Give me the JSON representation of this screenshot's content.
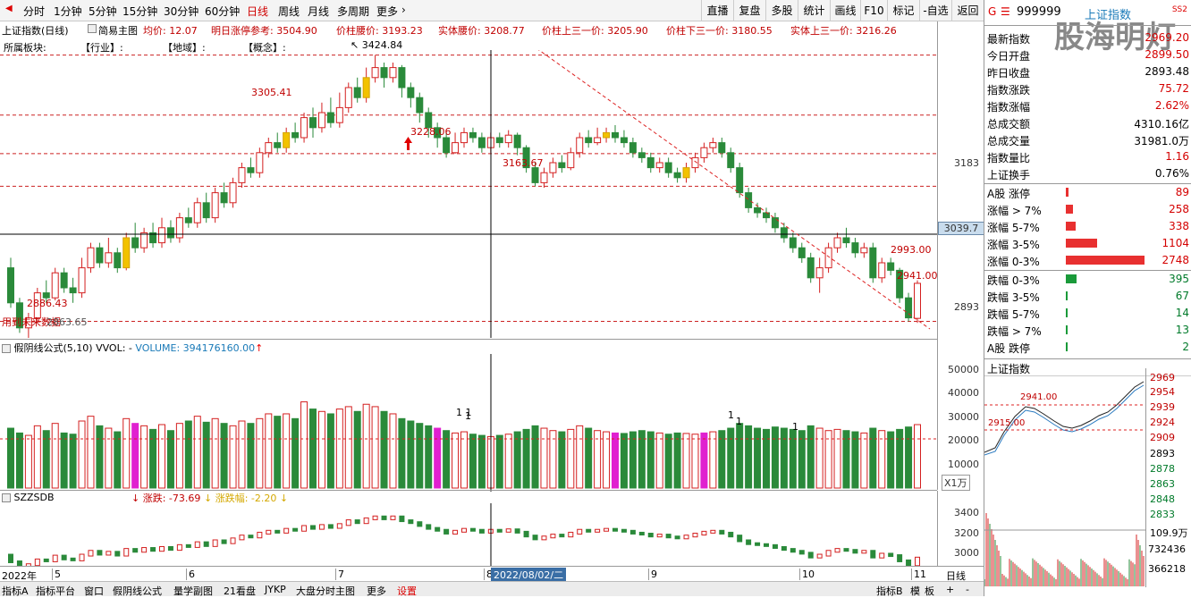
{
  "toolbar": {
    "periods": [
      "分时",
      "1分钟",
      "5分钟",
      "15分钟",
      "30分钟",
      "60分钟",
      "日线",
      "周线",
      "月线",
      "多周期",
      "更多"
    ],
    "active": "日线",
    "right_buttons": [
      "直播",
      "复盘",
      "多股",
      "统计",
      "画线",
      "F10",
      "标记",
      "-自选",
      "返回"
    ]
  },
  "header": {
    "name": "上证指数(日线)",
    "mode": "简易主图",
    "avg": "均价: 12.07",
    "limit_ref": "明日涨停参考: 3504.90",
    "mid": "价柱腰价: 3193.23",
    "body_mid": "实体腰价: 3208.77",
    "up_third": "价柱上三一价: 3205.90",
    "down_third": "价柱下三一价: 3180.55",
    "body_up_third": "实体上三一价: 3216.26"
  },
  "categories": [
    "所属板块:",
    "【行业】:",
    "【地域】:",
    "【概念】:"
  ],
  "chart_labels": {
    "high": "3424.84",
    "p3305": "3305.41",
    "p3228": "3228.06",
    "p3163": "3163.67",
    "p2886": "2886.43",
    "p2993": "2993.00",
    "p2941": "2941.00",
    "bottom_note": "用到未来数据",
    "bottom_val": "2863.65",
    "watermark": "股海明灯"
  },
  "price_axis": {
    "v3183": "3183",
    "current": "3039.7",
    "v2893": "2893"
  },
  "vol_panel": {
    "title": "假阴线公式(5,10)  VVOL: - ",
    "volume": "VOLUME: 394176160.00",
    "unit": "X1万",
    "ticks": [
      "50000",
      "40000",
      "30000",
      "20000",
      "10000"
    ]
  },
  "ind_panel": {
    "title": "SZZSDB",
    "chg": "涨跌: -73.69",
    "pct": "涨跌幅: -2.20",
    "ticks": [
      "3400",
      "3200",
      "3000"
    ]
  },
  "dates": {
    "y2022": "2022年",
    "m5": "5",
    "m6": "6",
    "m7": "7",
    "m8": "8",
    "sel": "2022/08/02/二",
    "m9": "9",
    "m10": "10",
    "m11": "11",
    "period_btn": "日线"
  },
  "bottom_tabs": [
    "指标A",
    "指标平台",
    "窗口",
    "假阴线公式",
    "量学副图",
    "21看盘",
    "JYKP",
    "大盘分时主图",
    "更多",
    "设置"
  ],
  "bottom_right": [
    "指标B",
    "模",
    "板",
    "+",
    "-"
  ],
  "right_panel": {
    "code": "999999",
    "name": "上证指数",
    "flag": "G",
    "tag": "SS2",
    "stats": [
      {
        "label": "最新指数",
        "value": "2969.20",
        "color": "red"
      },
      {
        "label": "今日开盘",
        "value": "2899.50",
        "color": "red"
      },
      {
        "label": "昨日收盘",
        "value": "2893.48",
        "color": "black"
      },
      {
        "label": "指数涨跌",
        "value": "75.72",
        "color": "red"
      },
      {
        "label": "指数涨幅",
        "value": "2.62%",
        "color": "red"
      },
      {
        "label": "总成交额",
        "value": "4310.16亿",
        "color": "black"
      },
      {
        "label": "总成交量",
        "value": "31981.0万",
        "color": "black"
      },
      {
        "label": "指数量比",
        "value": "1.16",
        "color": "red"
      },
      {
        "label": "上证换手",
        "value": "0.76%",
        "color": "black"
      }
    ],
    "up_rows": [
      {
        "label": "A股 涨停",
        "value": "89",
        "frac": 0.03
      },
      {
        "label": "涨幅 > 7%",
        "value": "258",
        "frac": 0.09
      },
      {
        "label": "涨幅 5-7%",
        "value": "338",
        "frac": 0.12
      },
      {
        "label": "涨幅 3-5%",
        "value": "1104",
        "frac": 0.4
      },
      {
        "label": "涨幅 0-3%",
        "value": "2748",
        "frac": 1.0
      }
    ],
    "down_rows": [
      {
        "label": "跌幅 0-3%",
        "value": "395",
        "frac": 0.14
      },
      {
        "label": "跌幅 3-5%",
        "value": "67",
        "frac": 0.02
      },
      {
        "label": "跌幅 5-7%",
        "value": "14",
        "frac": 0.01
      },
      {
        "label": "跌幅 > 7%",
        "value": "13",
        "frac": 0.01
      },
      {
        "label": "A股 跌停",
        "value": "2",
        "frac": 0.005
      }
    ],
    "mini_title": "上证指数",
    "mini_axis": [
      "2969",
      "2954",
      "2939",
      "2924",
      "2909",
      "2893",
      "2878",
      "2863",
      "2848",
      "2833"
    ],
    "mini_labels": {
      "l2941": "2941.00",
      "l2915": "2915.00",
      "vol_unit": "109.9万",
      "v1": "732436",
      "v2": "366218"
    }
  },
  "chart_data": {
    "type": "candlestick",
    "title": "上证指数(日线)",
    "points": [
      [
        3000,
        2930,
        3020,
        2920,
        250
      ],
      [
        2930,
        2880,
        2940,
        2870,
        230
      ],
      [
        2880,
        2900,
        2910,
        2860,
        220
      ],
      [
        2900,
        2950,
        2960,
        2890,
        260
      ],
      [
        2950,
        2940,
        2975,
        2930,
        240
      ],
      [
        2940,
        2990,
        3000,
        2935,
        270
      ],
      [
        2990,
        2960,
        3000,
        2950,
        230
      ],
      [
        2960,
        2950,
        2980,
        2930,
        225
      ],
      [
        2950,
        3000,
        3020,
        2940,
        280
      ],
      [
        3000,
        3040,
        3050,
        2990,
        300
      ],
      [
        3040,
        3010,
        3050,
        3000,
        260
      ],
      [
        3010,
        3030,
        3060,
        3000,
        250
      ],
      [
        3030,
        3000,
        3040,
        2990,
        235
      ],
      [
        3000,
        3060,
        3070,
        2995,
        290
      ],
      [
        3060,
        3040,
        3090,
        3030,
        270
      ],
      [
        3040,
        3070,
        3080,
        3030,
        260
      ],
      [
        3070,
        3050,
        3090,
        3040,
        245
      ],
      [
        3050,
        3080,
        3100,
        3040,
        265
      ],
      [
        3080,
        3060,
        3095,
        3050,
        240
      ],
      [
        3060,
        3100,
        3110,
        3050,
        270
      ],
      [
        3100,
        3090,
        3120,
        3080,
        280
      ],
      [
        3090,
        3130,
        3140,
        3080,
        300
      ],
      [
        3130,
        3100,
        3150,
        3090,
        275
      ],
      [
        3100,
        3150,
        3160,
        3090,
        290
      ],
      [
        3150,
        3130,
        3170,
        3120,
        270
      ],
      [
        3130,
        3170,
        3180,
        3120,
        260
      ],
      [
        3170,
        3200,
        3210,
        3160,
        280
      ],
      [
        3200,
        3190,
        3220,
        3180,
        270
      ],
      [
        3190,
        3230,
        3240,
        3180,
        290
      ],
      [
        3230,
        3250,
        3260,
        3220,
        310
      ],
      [
        3250,
        3240,
        3270,
        3230,
        300
      ],
      [
        3240,
        3270,
        3280,
        3230,
        310
      ],
      [
        3270,
        3260,
        3290,
        3250,
        290
      ],
      [
        3260,
        3300,
        3310,
        3250,
        360
      ],
      [
        3300,
        3280,
        3320,
        3260,
        330
      ],
      [
        3280,
        3310,
        3330,
        3270,
        320
      ],
      [
        3310,
        3290,
        3340,
        3280,
        310
      ],
      [
        3290,
        3320,
        3350,
        3280,
        330
      ],
      [
        3320,
        3360,
        3370,
        3310,
        340
      ],
      [
        3360,
        3340,
        3380,
        3330,
        320
      ],
      [
        3340,
        3380,
        3400,
        3330,
        350
      ],
      [
        3380,
        3400,
        3425,
        3370,
        340
      ],
      [
        3400,
        3380,
        3410,
        3360,
        320
      ],
      [
        3380,
        3400,
        3410,
        3370,
        310
      ],
      [
        3400,
        3360,
        3405,
        3340,
        290
      ],
      [
        3360,
        3340,
        3370,
        3320,
        280
      ],
      [
        3340,
        3310,
        3350,
        3290,
        270
      ],
      [
        3310,
        3280,
        3320,
        3260,
        260
      ],
      [
        3280,
        3260,
        3290,
        3240,
        250
      ],
      [
        3260,
        3230,
        3270,
        3220,
        240
      ],
      [
        3230,
        3250,
        3270,
        3228,
        230
      ],
      [
        3250,
        3270,
        3280,
        3240,
        235
      ],
      [
        3270,
        3260,
        3280,
        3250,
        225
      ],
      [
        3260,
        3240,
        3270,
        3230,
        220
      ],
      [
        3240,
        3260,
        3270,
        3230,
        215
      ],
      [
        3260,
        3250,
        3270,
        3240,
        220
      ],
      [
        3250,
        3265,
        3275,
        3240,
        225
      ],
      [
        3265,
        3240,
        3270,
        3225,
        235
      ],
      [
        3240,
        3200,
        3245,
        3190,
        245
      ],
      [
        3200,
        3170,
        3210,
        3163,
        260
      ],
      [
        3170,
        3190,
        3200,
        3160,
        250
      ],
      [
        3190,
        3210,
        3220,
        3180,
        240
      ],
      [
        3210,
        3200,
        3225,
        3190,
        235
      ],
      [
        3200,
        3230,
        3240,
        3195,
        245
      ],
      [
        3230,
        3260,
        3270,
        3220,
        260
      ],
      [
        3260,
        3250,
        3275,
        3240,
        250
      ],
      [
        3250,
        3260,
        3280,
        3245,
        240
      ],
      [
        3260,
        3270,
        3280,
        3250,
        235
      ],
      [
        3270,
        3260,
        3285,
        3250,
        230
      ],
      [
        3260,
        3250,
        3275,
        3240,
        228
      ],
      [
        3250,
        3230,
        3260,
        3220,
        235
      ],
      [
        3230,
        3220,
        3240,
        3210,
        240
      ],
      [
        3220,
        3200,
        3230,
        3190,
        235
      ],
      [
        3200,
        3210,
        3220,
        3190,
        230
      ],
      [
        3210,
        3190,
        3220,
        3180,
        225
      ],
      [
        3190,
        3180,
        3200,
        3170,
        230
      ],
      [
        3180,
        3200,
        3210,
        3170,
        228
      ],
      [
        3200,
        3220,
        3230,
        3190,
        225
      ],
      [
        3220,
        3240,
        3250,
        3210,
        230
      ],
      [
        3240,
        3250,
        3260,
        3230,
        235
      ],
      [
        3250,
        3230,
        3260,
        3220,
        240
      ],
      [
        3230,
        3200,
        3240,
        3190,
        250
      ],
      [
        3200,
        3150,
        3210,
        3140,
        270
      ],
      [
        3150,
        3120,
        3160,
        3110,
        260
      ],
      [
        3120,
        3110,
        3130,
        3100,
        250
      ],
      [
        3110,
        3100,
        3120,
        3090,
        245
      ],
      [
        3100,
        3080,
        3110,
        3070,
        255
      ],
      [
        3080,
        3060,
        3090,
        3050,
        250
      ],
      [
        3060,
        3040,
        3070,
        3030,
        245
      ],
      [
        3040,
        3020,
        3050,
        3010,
        240
      ],
      [
        3020,
        2980,
        3030,
        2970,
        260
      ],
      [
        2980,
        3000,
        3020,
        2950,
        250
      ],
      [
        3000,
        3040,
        3050,
        2990,
        240
      ],
      [
        3040,
        3060,
        3070,
        3030,
        245
      ],
      [
        3060,
        3050,
        3080,
        3040,
        240
      ],
      [
        3050,
        3030,
        3060,
        3020,
        235
      ],
      [
        3030,
        3040,
        3050,
        3020,
        230
      ],
      [
        3040,
        2980,
        3050,
        2970,
        250
      ],
      [
        2980,
        3010,
        3020,
        2970,
        240
      ],
      [
        3010,
        2995,
        3020,
        2985,
        235
      ],
      [
        2995,
        2940,
        3000,
        2930,
        245
      ],
      [
        2940,
        2900,
        2950,
        2893,
        255
      ],
      [
        2899,
        2969,
        2975,
        2890,
        265
      ]
    ]
  }
}
